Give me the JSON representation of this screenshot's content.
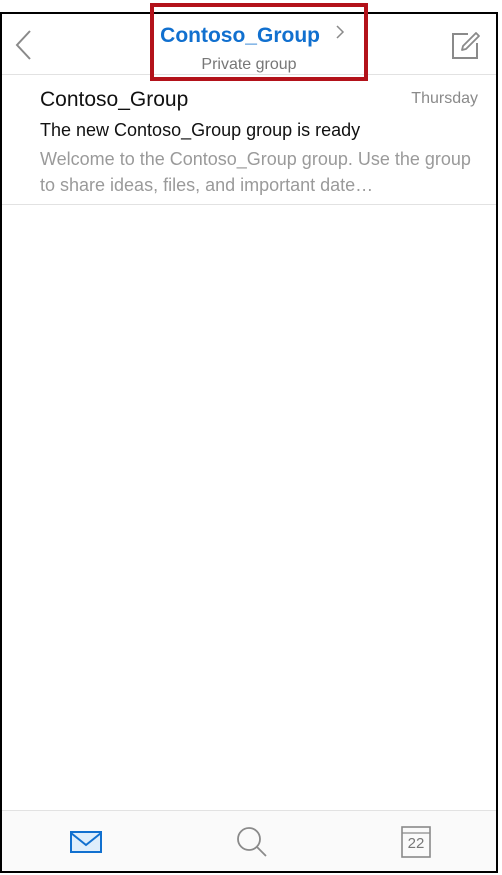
{
  "header": {
    "group_name": "Contoso_Group",
    "group_type": "Private group",
    "icons": {
      "back": "chevron-left-icon",
      "compose": "compose-icon",
      "title_chevron": "chevron-right-icon"
    }
  },
  "messages": [
    {
      "sender": "Contoso_Group",
      "date": "Thursday",
      "subject": "The new Contoso_Group group is ready",
      "preview": "Welcome to the Contoso_Group group. Use the group to share ideas, files, and important date…"
    }
  ],
  "tabbar": {
    "tabs": [
      {
        "name": "mail",
        "icon": "mail-icon",
        "active": true
      },
      {
        "name": "search",
        "icon": "search-icon",
        "active": false
      },
      {
        "name": "calendar",
        "icon": "calendar-icon",
        "active": false,
        "day": "22"
      }
    ]
  },
  "colors": {
    "accent": "#1170cf",
    "highlight_border": "#b3121a",
    "muted": "#9a9a9a"
  }
}
